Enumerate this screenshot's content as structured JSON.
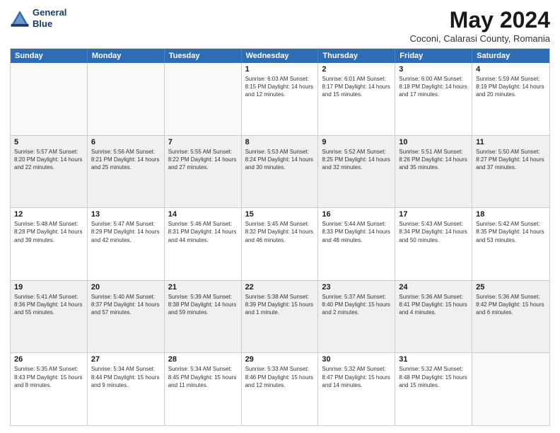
{
  "logo": {
    "line1": "General",
    "line2": "Blue"
  },
  "title": "May 2024",
  "subtitle": "Coconi, Calarasi County, Romania",
  "header_days": [
    "Sunday",
    "Monday",
    "Tuesday",
    "Wednesday",
    "Thursday",
    "Friday",
    "Saturday"
  ],
  "rows": [
    [
      {
        "day": "",
        "info": "",
        "shaded": false,
        "empty": true
      },
      {
        "day": "",
        "info": "",
        "shaded": false,
        "empty": true
      },
      {
        "day": "",
        "info": "",
        "shaded": false,
        "empty": true
      },
      {
        "day": "1",
        "info": "Sunrise: 6:03 AM\nSunset: 8:15 PM\nDaylight: 14 hours\nand 12 minutes.",
        "shaded": false,
        "empty": false
      },
      {
        "day": "2",
        "info": "Sunrise: 6:01 AM\nSunset: 8:17 PM\nDaylight: 14 hours\nand 15 minutes.",
        "shaded": false,
        "empty": false
      },
      {
        "day": "3",
        "info": "Sunrise: 6:00 AM\nSunset: 8:18 PM\nDaylight: 14 hours\nand 17 minutes.",
        "shaded": false,
        "empty": false
      },
      {
        "day": "4",
        "info": "Sunrise: 5:59 AM\nSunset: 8:19 PM\nDaylight: 14 hours\nand 20 minutes.",
        "shaded": false,
        "empty": false
      }
    ],
    [
      {
        "day": "5",
        "info": "Sunrise: 5:57 AM\nSunset: 8:20 PM\nDaylight: 14 hours\nand 22 minutes.",
        "shaded": true,
        "empty": false
      },
      {
        "day": "6",
        "info": "Sunrise: 5:56 AM\nSunset: 8:21 PM\nDaylight: 14 hours\nand 25 minutes.",
        "shaded": true,
        "empty": false
      },
      {
        "day": "7",
        "info": "Sunrise: 5:55 AM\nSunset: 8:22 PM\nDaylight: 14 hours\nand 27 minutes.",
        "shaded": true,
        "empty": false
      },
      {
        "day": "8",
        "info": "Sunrise: 5:53 AM\nSunset: 8:24 PM\nDaylight: 14 hours\nand 30 minutes.",
        "shaded": true,
        "empty": false
      },
      {
        "day": "9",
        "info": "Sunrise: 5:52 AM\nSunset: 8:25 PM\nDaylight: 14 hours\nand 32 minutes.",
        "shaded": true,
        "empty": false
      },
      {
        "day": "10",
        "info": "Sunrise: 5:51 AM\nSunset: 8:26 PM\nDaylight: 14 hours\nand 35 minutes.",
        "shaded": true,
        "empty": false
      },
      {
        "day": "11",
        "info": "Sunrise: 5:50 AM\nSunset: 8:27 PM\nDaylight: 14 hours\nand 37 minutes.",
        "shaded": true,
        "empty": false
      }
    ],
    [
      {
        "day": "12",
        "info": "Sunrise: 5:48 AM\nSunset: 8:28 PM\nDaylight: 14 hours\nand 39 minutes.",
        "shaded": false,
        "empty": false
      },
      {
        "day": "13",
        "info": "Sunrise: 5:47 AM\nSunset: 8:29 PM\nDaylight: 14 hours\nand 42 minutes.",
        "shaded": false,
        "empty": false
      },
      {
        "day": "14",
        "info": "Sunrise: 5:46 AM\nSunset: 8:31 PM\nDaylight: 14 hours\nand 44 minutes.",
        "shaded": false,
        "empty": false
      },
      {
        "day": "15",
        "info": "Sunrise: 5:45 AM\nSunset: 8:32 PM\nDaylight: 14 hours\nand 46 minutes.",
        "shaded": false,
        "empty": false
      },
      {
        "day": "16",
        "info": "Sunrise: 5:44 AM\nSunset: 8:33 PM\nDaylight: 14 hours\nand 48 minutes.",
        "shaded": false,
        "empty": false
      },
      {
        "day": "17",
        "info": "Sunrise: 5:43 AM\nSunset: 8:34 PM\nDaylight: 14 hours\nand 50 minutes.",
        "shaded": false,
        "empty": false
      },
      {
        "day": "18",
        "info": "Sunrise: 5:42 AM\nSunset: 8:35 PM\nDaylight: 14 hours\nand 53 minutes.",
        "shaded": false,
        "empty": false
      }
    ],
    [
      {
        "day": "19",
        "info": "Sunrise: 5:41 AM\nSunset: 8:36 PM\nDaylight: 14 hours\nand 55 minutes.",
        "shaded": true,
        "empty": false
      },
      {
        "day": "20",
        "info": "Sunrise: 5:40 AM\nSunset: 8:37 PM\nDaylight: 14 hours\nand 57 minutes.",
        "shaded": true,
        "empty": false
      },
      {
        "day": "21",
        "info": "Sunrise: 5:39 AM\nSunset: 8:38 PM\nDaylight: 14 hours\nand 59 minutes.",
        "shaded": true,
        "empty": false
      },
      {
        "day": "22",
        "info": "Sunrise: 5:38 AM\nSunset: 8:39 PM\nDaylight: 15 hours\nand 1 minute.",
        "shaded": true,
        "empty": false
      },
      {
        "day": "23",
        "info": "Sunrise: 5:37 AM\nSunset: 8:40 PM\nDaylight: 15 hours\nand 2 minutes.",
        "shaded": true,
        "empty": false
      },
      {
        "day": "24",
        "info": "Sunrise: 5:36 AM\nSunset: 8:41 PM\nDaylight: 15 hours\nand 4 minutes.",
        "shaded": true,
        "empty": false
      },
      {
        "day": "25",
        "info": "Sunrise: 5:36 AM\nSunset: 8:42 PM\nDaylight: 15 hours\nand 6 minutes.",
        "shaded": true,
        "empty": false
      }
    ],
    [
      {
        "day": "26",
        "info": "Sunrise: 5:35 AM\nSunset: 8:43 PM\nDaylight: 15 hours\nand 8 minutes.",
        "shaded": false,
        "empty": false
      },
      {
        "day": "27",
        "info": "Sunrise: 5:34 AM\nSunset: 8:44 PM\nDaylight: 15 hours\nand 9 minutes.",
        "shaded": false,
        "empty": false
      },
      {
        "day": "28",
        "info": "Sunrise: 5:34 AM\nSunset: 8:45 PM\nDaylight: 15 hours\nand 11 minutes.",
        "shaded": false,
        "empty": false
      },
      {
        "day": "29",
        "info": "Sunrise: 5:33 AM\nSunset: 8:46 PM\nDaylight: 15 hours\nand 12 minutes.",
        "shaded": false,
        "empty": false
      },
      {
        "day": "30",
        "info": "Sunrise: 5:32 AM\nSunset: 8:47 PM\nDaylight: 15 hours\nand 14 minutes.",
        "shaded": false,
        "empty": false
      },
      {
        "day": "31",
        "info": "Sunrise: 5:32 AM\nSunset: 8:48 PM\nDaylight: 15 hours\nand 15 minutes.",
        "shaded": false,
        "empty": false
      },
      {
        "day": "",
        "info": "",
        "shaded": false,
        "empty": true
      }
    ]
  ]
}
